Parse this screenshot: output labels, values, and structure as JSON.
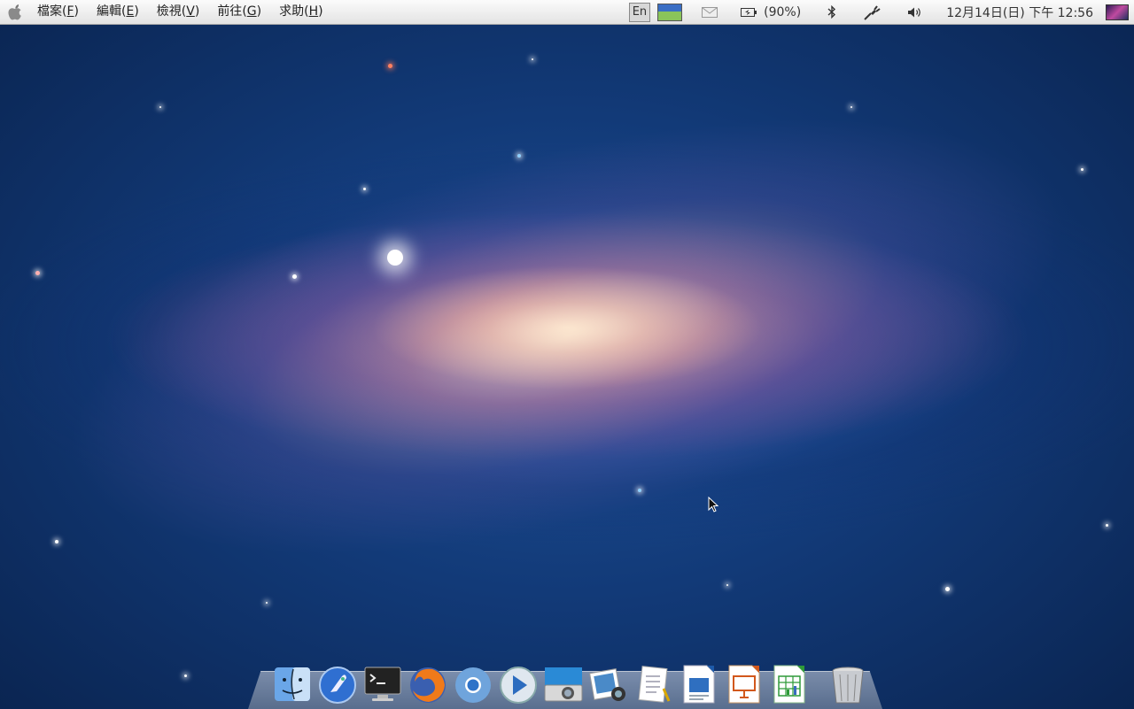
{
  "menubar": {
    "menus": [
      {
        "label": "檔案",
        "mnemonic": "F"
      },
      {
        "label": "編輯",
        "mnemonic": "E"
      },
      {
        "label": "檢視",
        "mnemonic": "V"
      },
      {
        "label": "前往",
        "mnemonic": "G"
      },
      {
        "label": "求助",
        "mnemonic": "H"
      }
    ],
    "status": {
      "input_method": "En",
      "battery": "(90%)",
      "clock": "12月14日(日) 下午 12:56"
    }
  },
  "dock": {
    "apps": [
      {
        "icon": "finder-icon"
      },
      {
        "icon": "launchpad-icon"
      },
      {
        "icon": "terminal-icon"
      },
      {
        "icon": "firefox-icon"
      },
      {
        "icon": "chromium-icon"
      },
      {
        "icon": "media-player-icon"
      },
      {
        "icon": "camera-icon"
      },
      {
        "icon": "photos-icon"
      },
      {
        "icon": "text-document-icon"
      },
      {
        "icon": "writer-icon"
      },
      {
        "icon": "impress-icon"
      },
      {
        "icon": "calc-icon"
      },
      {
        "icon": "trash-icon"
      }
    ]
  }
}
